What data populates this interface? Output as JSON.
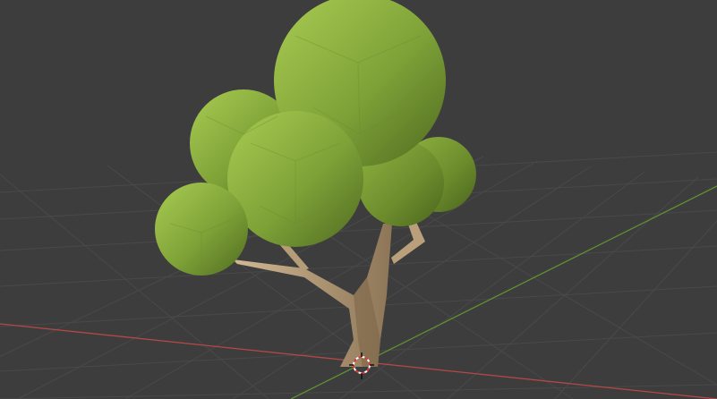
{
  "viewport": {
    "background": "#3d3d3d",
    "grid_color": "#4a4a4a",
    "x_axis_color": "#c44a4a",
    "y_axis_color": "#6b9a3a"
  },
  "scene_objects": [
    {
      "name": "tree",
      "parts": [
        "trunk",
        "branches",
        "foliage"
      ]
    }
  ],
  "colors": {
    "foliage_light": "#9cc24a",
    "foliage_mid": "#7fa238",
    "foliage_dark": "#5f7f27",
    "trunk_light": "#c9b08a",
    "trunk_dark": "#8d7657"
  },
  "cursor": {
    "icon": "3d-cursor-icon"
  }
}
